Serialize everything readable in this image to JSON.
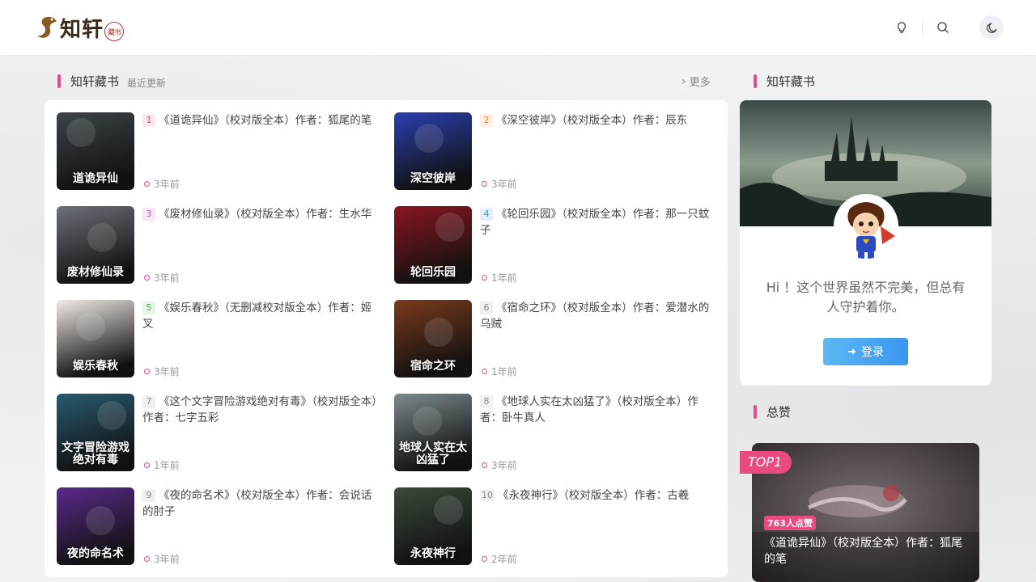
{
  "site": {
    "logo_text": "知轩",
    "logo_seal": "藏书"
  },
  "header": {
    "icons": [
      "bulb-icon",
      "search-icon",
      "moon-icon"
    ]
  },
  "main_section": {
    "title": "知轩藏书",
    "subtitle": "最近更新",
    "more_label": "更多"
  },
  "books": [
    {
      "rank": "1",
      "title": "《道诡异仙》（校对版全本）作者：狐尾的笔",
      "time": "3年前",
      "cover_text": "道诡异仙",
      "cover_color": "#3c4548"
    },
    {
      "rank": "2",
      "title": "《深空彼岸》（校对版全本）作者：辰东",
      "time": "3年前",
      "cover_text": "深空彼岸",
      "cover_color": "#2a3fb0"
    },
    {
      "rank": "3",
      "title": "《废材修仙录》（校对版全本）作者：生水华",
      "time": "3年前",
      "cover_text": "废材修仙录",
      "cover_color": "#6d7178"
    },
    {
      "rank": "4",
      "title": "《轮回乐园》（校对版全本）作者：那一只蚊子",
      "time": "1年前",
      "cover_text": "轮回乐园",
      "cover_color": "#8a1620"
    },
    {
      "rank": "5",
      "title": "《娱乐春秋》（无删减校对版全本）作者：姬叉",
      "time": "3年前",
      "cover_text": "娱乐春秋",
      "cover_color": "#f1ece6"
    },
    {
      "rank": "6",
      "title": "《宿命之环》（校对版全本）作者：爱潜水的乌贼",
      "time": "1年前",
      "cover_text": "宿命之环",
      "cover_color": "#7a3a1c"
    },
    {
      "rank": "7",
      "title": "《这个文字冒险游戏绝对有毒》（校对版全本）作者：七字五彩",
      "time": "1年前",
      "cover_text": "文字冒险游戏绝对有毒",
      "cover_color": "#2a5a70"
    },
    {
      "rank": "8",
      "title": "《地球人实在太凶猛了》（校对版全本）作者：卧牛真人",
      "time": "3年前",
      "cover_text": "地球人实在太凶猛了",
      "cover_color": "#7c8a8c"
    },
    {
      "rank": "9",
      "title": "《夜的命名术》（校对版全本）作者：会说话的肘子",
      "time": "3年前",
      "cover_text": "夜的命名术",
      "cover_color": "#5a2a8a"
    },
    {
      "rank": "10",
      "title": "《永夜神行》（校对版全本）作者：古羲",
      "time": "2年前",
      "cover_text": "永夜神行",
      "cover_color": "#3a4a3a"
    }
  ],
  "sidebar": {
    "profile_title": "知轩藏书",
    "motto": "Hi ！这个世界虽然不完美，但总有人守护着你。",
    "login_label": "登录",
    "likes_title": "总赞",
    "top_badge": "TOP1",
    "top_likes": "763人点赞",
    "top_book_title": "《道诡异仙》（校对版全本）作者：狐尾的笔"
  },
  "colors": {
    "accent": "#e34a8a",
    "login_button": "#3a96ef"
  }
}
